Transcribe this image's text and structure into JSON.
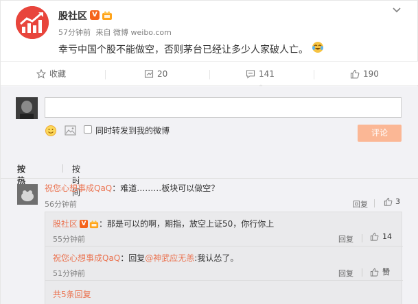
{
  "post": {
    "author": "股社区",
    "time": "57分钟前",
    "source_prefix": "来自",
    "source": "微博 weibo.com",
    "content": "幸亏中国个股不能做空，否则茅台已经让多少人家破人亡。",
    "verified_badge": "V"
  },
  "actions": {
    "favorite_label": "收藏",
    "forward_count": "20",
    "comment_count": "141",
    "like_count": "190"
  },
  "composer": {
    "input_value": "",
    "also_forward_label": "同时转发到我的微博",
    "submit_label": "评论"
  },
  "sort": {
    "hot_label": "按热度",
    "time_label": "按时间"
  },
  "comment": {
    "user": "祝您心想事成QaQ",
    "text": "：难道………板块可以做空？",
    "time": "56分钟前",
    "reply_label": "回复",
    "like_count": "3"
  },
  "replies": [
    {
      "user": "股社区",
      "verified_badge": "V",
      "text": "：那是可以的啊，期指，放空上证50，你行你上",
      "time": "55分钟前",
      "reply_label": "回复",
      "like_label": "14"
    },
    {
      "user": "祝您心想事成QaQ",
      "text_prefix": "：回复",
      "mention": "@神武应无恙",
      "text": ":我认怂了。",
      "time": "51分钟前",
      "reply_label": "回复",
      "like_label": "赞"
    }
  ],
  "more_replies": "共5条回复",
  "colors": {
    "accent": "#eb7350",
    "submit_bg": "#fbb795",
    "verified": "#f5631c",
    "comment_area_bg": "#f2f2f5"
  }
}
